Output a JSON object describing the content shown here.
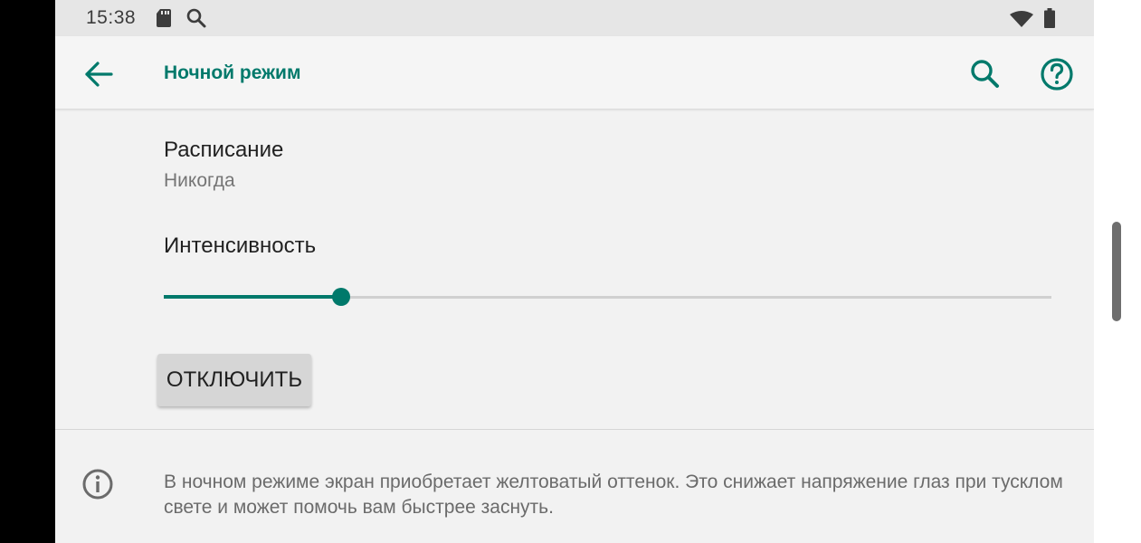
{
  "status_bar": {
    "time": "15:38",
    "icons": [
      "sd-card-icon",
      "search-icon",
      "wifi-icon",
      "battery-icon"
    ]
  },
  "app_bar": {
    "title": "Ночной режим",
    "back_icon": "arrow-back-icon",
    "search_icon": "search-icon",
    "help_icon": "help-circle-icon"
  },
  "schedule": {
    "title": "Расписание",
    "summary": "Никогда"
  },
  "intensity": {
    "title": "Интенсивность",
    "value_fraction": 0.2
  },
  "toggle_button": {
    "label": "ОТКЛЮЧИТЬ"
  },
  "footer": {
    "icon": "info-icon",
    "text": "В ночном режиме экран приобретает желтоватый оттенок. Это снижает напряжение глаз при тусклом свете и может помочь вам быстрее заснуть."
  },
  "colors": {
    "accent": "#00796b",
    "background": "#f2f2f2",
    "status_bar": "#e6e6e6",
    "text_primary": "#212121",
    "text_secondary": "#757575"
  }
}
